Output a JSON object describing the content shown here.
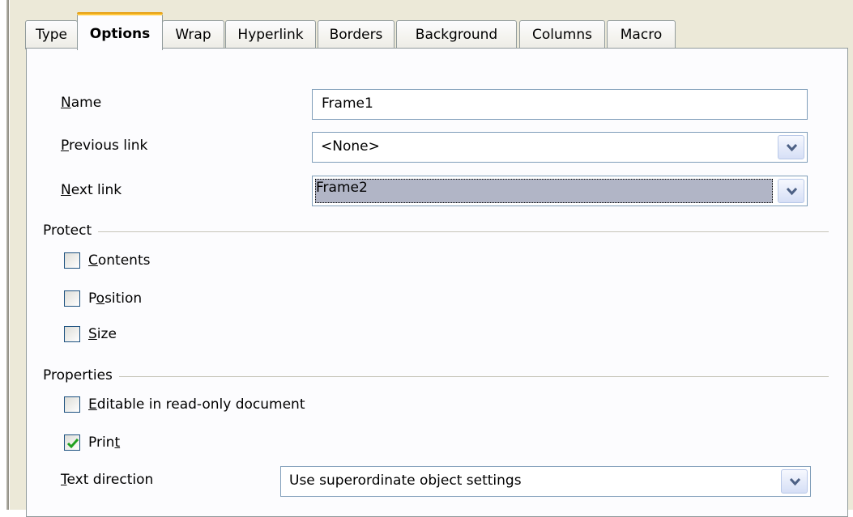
{
  "tabs": [
    {
      "label": "Type",
      "active": false
    },
    {
      "label": "Options",
      "active": true
    },
    {
      "label": "Wrap",
      "active": false
    },
    {
      "label": "Hyperlink",
      "active": false
    },
    {
      "label": "Borders",
      "active": false
    },
    {
      "label": "Background",
      "active": false
    },
    {
      "label": "Columns",
      "active": false
    },
    {
      "label": "Macro",
      "active": false
    }
  ],
  "fields": {
    "name": {
      "label_key": "N",
      "label_rest": "ame",
      "value": "Frame1"
    },
    "previous_link": {
      "label_key": "P",
      "label_rest": "revious link",
      "value": "<None>"
    },
    "next_link": {
      "label_key": "N",
      "label_rest": "ext link",
      "value": "Frame2"
    }
  },
  "protect": {
    "title": "Protect",
    "contents": {
      "label_key": "C",
      "label_rest": "ontents",
      "checked": false
    },
    "position": {
      "label_pre": "P",
      "label_key": "o",
      "label_rest": "sition",
      "checked": false
    },
    "size": {
      "label_key": "S",
      "label_rest": "ize",
      "checked": false
    }
  },
  "properties": {
    "title": "Properties",
    "editable": {
      "label_key": "E",
      "label_rest": "ditable in read-only document",
      "checked": false
    },
    "print": {
      "label_pre": "Prin",
      "label_key": "t",
      "checked": true
    },
    "text_direction": {
      "label_key": "T",
      "label_rest": "ext direction",
      "value": "Use superordinate object settings"
    }
  },
  "colors": {
    "tab_highlight": "#ffc83c",
    "checkmark": "#21a121",
    "focus_fill": "#b1b5c6"
  }
}
